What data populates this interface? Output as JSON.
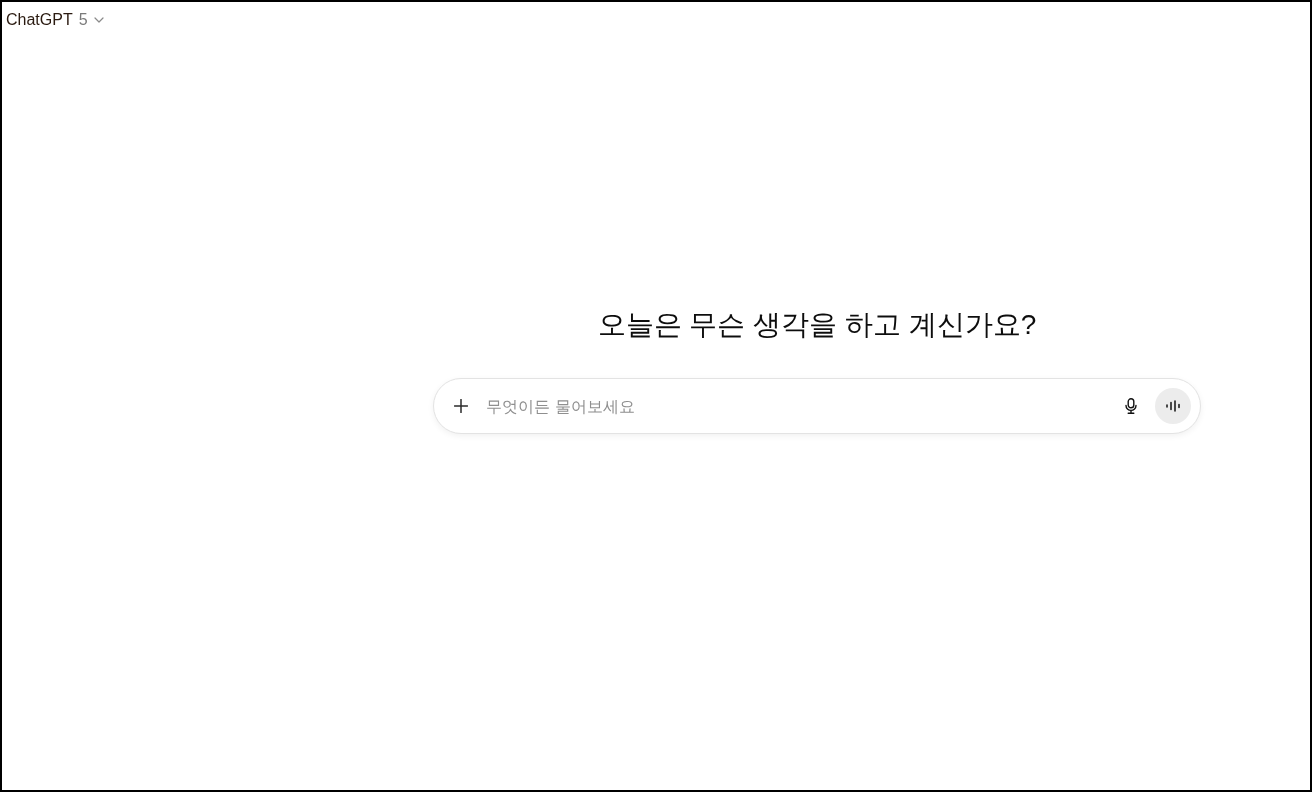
{
  "header": {
    "title": "ChatGPT",
    "version": "5"
  },
  "heading": "오늘은 무슨 생각을 하고 계신가요?",
  "composer": {
    "placeholder": "무엇이든 물어보세요"
  }
}
